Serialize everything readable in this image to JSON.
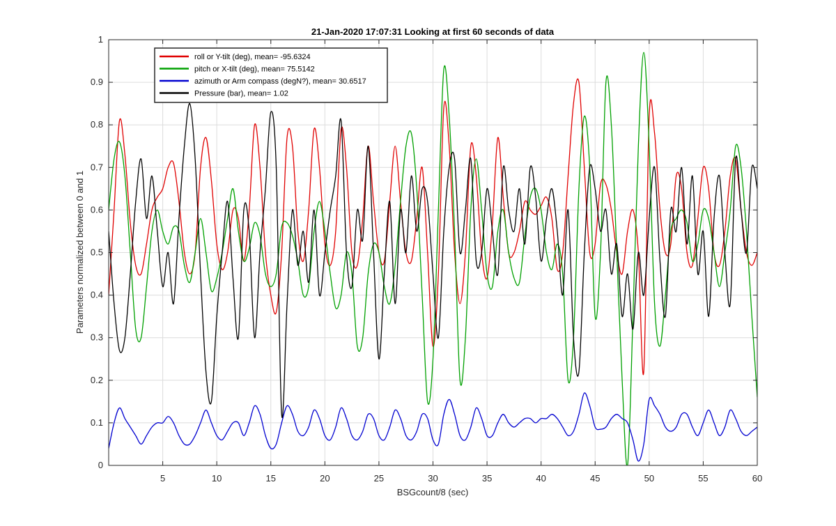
{
  "chart_data": {
    "type": "line",
    "title": "21-Jan-2020 17:07:31 Looking at first 60 seconds of data",
    "xlabel": "BSGcount/8 (sec)",
    "ylabel": "Parameters normalized between 0 and 1",
    "xlim": [
      0,
      60
    ],
    "ylim": [
      0,
      1
    ],
    "xticks": [
      5,
      10,
      15,
      20,
      25,
      30,
      35,
      40,
      45,
      50,
      55,
      60
    ],
    "yticks": [
      0,
      0.1,
      0.2,
      0.3,
      0.4,
      0.5,
      0.6,
      0.7,
      0.8,
      0.9,
      1
    ],
    "xtick_labels": [
      "5",
      "10",
      "15",
      "20",
      "25",
      "30",
      "35",
      "40",
      "45",
      "50",
      "55",
      "60"
    ],
    "ytick_labels": [
      "0",
      "0.1",
      "0.2",
      "0.3",
      "0.4",
      "0.5",
      "0.6",
      "0.7",
      "0.8",
      "0.9",
      "1"
    ],
    "grid": true,
    "legend_position": "top-left",
    "series": [
      {
        "name": "roll or Y-tilt (deg), mean= -95.6324",
        "color": "#e00000",
        "x": [
          0,
          0.5,
          1.0,
          1.5,
          2.0,
          2.5,
          3.0,
          3.5,
          4.0,
          4.5,
          5.0,
          5.5,
          6.0,
          6.5,
          7.0,
          7.5,
          8.0,
          8.5,
          9.0,
          9.5,
          10.0,
          10.5,
          11.0,
          11.5,
          12.0,
          12.5,
          13.0,
          13.5,
          14.0,
          14.5,
          15.0,
          15.5,
          16.0,
          16.5,
          17.0,
          17.5,
          18.0,
          18.5,
          19.0,
          19.5,
          20.0,
          20.5,
          21.0,
          21.5,
          22.0,
          22.5,
          23.0,
          23.5,
          24.0,
          24.5,
          25.0,
          25.5,
          26.0,
          26.5,
          27.0,
          27.5,
          28.0,
          28.5,
          29.0,
          29.5,
          30.0,
          30.5,
          31.0,
          31.5,
          32.0,
          32.5,
          33.0,
          33.5,
          34.0,
          34.5,
          35.0,
          35.5,
          36.0,
          36.5,
          37.0,
          37.5,
          38.0,
          38.5,
          39.0,
          39.5,
          40.0,
          40.5,
          41.0,
          41.5,
          42.0,
          42.5,
          43.0,
          43.5,
          44.0,
          44.5,
          45.0,
          45.5,
          46.0,
          46.5,
          47.0,
          47.5,
          48.0,
          48.5,
          49.0,
          49.5,
          50.0,
          50.5,
          51.0,
          51.5,
          52.0,
          52.5,
          53.0,
          53.5,
          54.0,
          54.5,
          55.0,
          55.5,
          56.0,
          56.5,
          57.0,
          57.5,
          58.0,
          58.5,
          59.0,
          59.5,
          60.0
        ],
        "y": [
          0.4,
          0.6,
          0.81,
          0.73,
          0.57,
          0.47,
          0.45,
          0.52,
          0.6,
          0.63,
          0.65,
          0.7,
          0.71,
          0.62,
          0.5,
          0.45,
          0.5,
          0.7,
          0.77,
          0.67,
          0.52,
          0.46,
          0.5,
          0.6,
          0.58,
          0.48,
          0.6,
          0.8,
          0.7,
          0.5,
          0.4,
          0.36,
          0.5,
          0.77,
          0.75,
          0.55,
          0.48,
          0.6,
          0.79,
          0.7,
          0.52,
          0.47,
          0.55,
          0.79,
          0.7,
          0.5,
          0.47,
          0.58,
          0.75,
          0.62,
          0.5,
          0.48,
          0.62,
          0.75,
          0.62,
          0.5,
          0.48,
          0.58,
          0.7,
          0.5,
          0.28,
          0.45,
          0.84,
          0.75,
          0.5,
          0.38,
          0.5,
          0.75,
          0.68,
          0.5,
          0.44,
          0.57,
          0.77,
          0.63,
          0.5,
          0.5,
          0.55,
          0.62,
          0.6,
          0.59,
          0.61,
          0.63,
          0.58,
          0.46,
          0.5,
          0.68,
          0.85,
          0.9,
          0.7,
          0.5,
          0.52,
          0.66,
          0.66,
          0.6,
          0.5,
          0.45,
          0.55,
          0.6,
          0.5,
          0.22,
          0.82,
          0.78,
          0.6,
          0.5,
          0.52,
          0.68,
          0.65,
          0.5,
          0.47,
          0.58,
          0.7,
          0.65,
          0.5,
          0.47,
          0.55,
          0.68,
          0.72,
          0.6,
          0.5,
          0.47,
          0.5
        ]
      },
      {
        "name": "pitch or X-tilt (deg), mean= 75.5142",
        "color": "#00a000",
        "x": [
          0,
          0.5,
          1.0,
          1.5,
          2.0,
          2.5,
          3.0,
          3.5,
          4.0,
          4.5,
          5.0,
          5.5,
          6.0,
          6.5,
          7.0,
          7.5,
          8.0,
          8.5,
          9.0,
          9.5,
          10.0,
          10.5,
          11.0,
          11.5,
          12.0,
          12.5,
          13.0,
          13.5,
          14.0,
          14.5,
          15.0,
          15.5,
          16.0,
          16.5,
          17.0,
          17.5,
          18.0,
          18.5,
          19.0,
          19.5,
          20.0,
          20.5,
          21.0,
          21.5,
          22.0,
          22.5,
          23.0,
          23.5,
          24.0,
          24.5,
          25.0,
          25.5,
          26.0,
          26.5,
          27.0,
          27.5,
          28.0,
          28.5,
          29.0,
          29.5,
          30.0,
          30.5,
          31.0,
          31.5,
          32.0,
          32.5,
          33.0,
          33.5,
          34.0,
          34.5,
          35.0,
          35.5,
          36.0,
          36.5,
          37.0,
          37.5,
          38.0,
          38.5,
          39.0,
          39.5,
          40.0,
          40.5,
          41.0,
          41.5,
          42.0,
          42.5,
          43.0,
          43.5,
          44.0,
          44.5,
          45.0,
          45.5,
          46.0,
          46.5,
          47.0,
          47.5,
          48.0,
          48.5,
          49.0,
          49.5,
          50.0,
          50.5,
          51.0,
          51.5,
          52.0,
          52.5,
          53.0,
          53.5,
          54.0,
          54.5,
          55.0,
          55.5,
          56.0,
          56.5,
          57.0,
          57.5,
          58.0,
          58.5,
          59.0,
          59.5,
          60.0
        ],
        "y": [
          0.6,
          0.72,
          0.76,
          0.68,
          0.5,
          0.32,
          0.3,
          0.42,
          0.55,
          0.6,
          0.55,
          0.52,
          0.56,
          0.55,
          0.47,
          0.43,
          0.5,
          0.58,
          0.5,
          0.41,
          0.44,
          0.5,
          0.58,
          0.65,
          0.55,
          0.48,
          0.51,
          0.57,
          0.54,
          0.45,
          0.42,
          0.45,
          0.56,
          0.57,
          0.54,
          0.48,
          0.4,
          0.42,
          0.55,
          0.62,
          0.55,
          0.45,
          0.37,
          0.4,
          0.5,
          0.45,
          0.28,
          0.3,
          0.45,
          0.52,
          0.5,
          0.42,
          0.38,
          0.47,
          0.62,
          0.75,
          0.78,
          0.65,
          0.4,
          0.15,
          0.25,
          0.6,
          0.93,
          0.82,
          0.55,
          0.2,
          0.3,
          0.6,
          0.72,
          0.6,
          0.45,
          0.42,
          0.55,
          0.6,
          0.5,
          0.44,
          0.43,
          0.54,
          0.63,
          0.65,
          0.6,
          0.5,
          0.46,
          0.52,
          0.45,
          0.2,
          0.3,
          0.65,
          0.82,
          0.7,
          0.35,
          0.5,
          0.9,
          0.8,
          0.5,
          0.2,
          0.0,
          0.35,
          0.75,
          0.97,
          0.75,
          0.38,
          0.28,
          0.4,
          0.55,
          0.58,
          0.6,
          0.57,
          0.48,
          0.52,
          0.6,
          0.58,
          0.5,
          0.42,
          0.5,
          0.6,
          0.75,
          0.7,
          0.55,
          0.35,
          0.16
        ]
      },
      {
        "name": "azimuth or Arm compass (degN?), mean= 30.6517",
        "color": "#0000d0",
        "x": [
          0,
          0.5,
          1.0,
          1.5,
          2.0,
          2.5,
          3.0,
          3.5,
          4.0,
          4.5,
          5.0,
          5.5,
          6.0,
          6.5,
          7.0,
          7.5,
          8.0,
          8.5,
          9.0,
          9.5,
          10.0,
          10.5,
          11.0,
          11.5,
          12.0,
          12.5,
          13.0,
          13.5,
          14.0,
          14.5,
          15.0,
          15.5,
          16.0,
          16.5,
          17.0,
          17.5,
          18.0,
          18.5,
          19.0,
          19.5,
          20.0,
          20.5,
          21.0,
          21.5,
          22.0,
          22.5,
          23.0,
          23.5,
          24.0,
          24.5,
          25.0,
          25.5,
          26.0,
          26.5,
          27.0,
          27.5,
          28.0,
          28.5,
          29.0,
          29.5,
          30.0,
          30.5,
          31.0,
          31.5,
          32.0,
          32.5,
          33.0,
          33.5,
          34.0,
          34.5,
          35.0,
          35.5,
          36.0,
          36.5,
          37.0,
          37.5,
          38.0,
          38.5,
          39.0,
          39.5,
          40.0,
          40.5,
          41.0,
          41.5,
          42.0,
          42.5,
          43.0,
          43.5,
          44.0,
          44.5,
          45.0,
          45.5,
          46.0,
          46.5,
          47.0,
          47.5,
          48.0,
          48.5,
          49.0,
          49.5,
          50.0,
          50.5,
          51.0,
          51.5,
          52.0,
          52.5,
          53.0,
          53.5,
          54.0,
          54.5,
          55.0,
          55.5,
          56.0,
          56.5,
          57.0,
          57.5,
          58.0,
          58.5,
          59.0,
          59.5,
          60.0
        ],
        "y": [
          0.04,
          0.1,
          0.135,
          0.11,
          0.09,
          0.07,
          0.05,
          0.07,
          0.09,
          0.1,
          0.1,
          0.115,
          0.1,
          0.07,
          0.05,
          0.05,
          0.07,
          0.1,
          0.13,
          0.1,
          0.07,
          0.06,
          0.08,
          0.1,
          0.1,
          0.07,
          0.1,
          0.14,
          0.12,
          0.07,
          0.04,
          0.05,
          0.1,
          0.14,
          0.12,
          0.08,
          0.07,
          0.09,
          0.13,
          0.11,
          0.07,
          0.06,
          0.09,
          0.135,
          0.11,
          0.07,
          0.06,
          0.08,
          0.12,
          0.11,
          0.07,
          0.06,
          0.09,
          0.13,
          0.11,
          0.07,
          0.06,
          0.08,
          0.12,
          0.11,
          0.06,
          0.05,
          0.12,
          0.155,
          0.12,
          0.07,
          0.06,
          0.09,
          0.135,
          0.11,
          0.07,
          0.07,
          0.1,
          0.12,
          0.1,
          0.09,
          0.1,
          0.11,
          0.11,
          0.1,
          0.11,
          0.11,
          0.12,
          0.11,
          0.09,
          0.07,
          0.08,
          0.12,
          0.17,
          0.14,
          0.09,
          0.085,
          0.09,
          0.11,
          0.12,
          0.11,
          0.1,
          0.06,
          0.01,
          0.05,
          0.155,
          0.14,
          0.12,
          0.09,
          0.08,
          0.09,
          0.12,
          0.12,
          0.09,
          0.07,
          0.1,
          0.13,
          0.1,
          0.07,
          0.09,
          0.13,
          0.11,
          0.08,
          0.07,
          0.08,
          0.09
        ]
      },
      {
        "name": "Pressure (bar), mean= 1.02",
        "color": "#000000",
        "x": [
          0,
          0.5,
          1.0,
          1.5,
          2.0,
          2.5,
          3.0,
          3.5,
          4.0,
          4.5,
          5.0,
          5.5,
          6.0,
          6.5,
          7.0,
          7.5,
          8.0,
          8.5,
          9.0,
          9.5,
          10.0,
          10.5,
          11.0,
          11.5,
          12.0,
          12.5,
          13.0,
          13.5,
          14.0,
          14.5,
          15.0,
          15.5,
          16.0,
          16.5,
          17.0,
          17.5,
          18.0,
          18.5,
          19.0,
          19.5,
          20.0,
          20.5,
          21.0,
          21.5,
          22.0,
          22.5,
          23.0,
          23.5,
          24.0,
          24.5,
          25.0,
          25.5,
          26.0,
          26.5,
          27.0,
          27.5,
          28.0,
          28.5,
          29.0,
          29.5,
          30.0,
          30.5,
          31.0,
          31.5,
          32.0,
          32.5,
          33.0,
          33.5,
          34.0,
          34.5,
          35.0,
          35.5,
          36.0,
          36.5,
          37.0,
          37.5,
          38.0,
          38.5,
          39.0,
          39.5,
          40.0,
          40.5,
          41.0,
          41.5,
          42.0,
          42.5,
          43.0,
          43.5,
          44.0,
          44.5,
          45.0,
          45.5,
          46.0,
          46.5,
          47.0,
          47.5,
          48.0,
          48.5,
          49.0,
          49.5,
          50.0,
          50.5,
          51.0,
          51.5,
          52.0,
          52.5,
          53.0,
          53.5,
          54.0,
          54.5,
          55.0,
          55.5,
          56.0,
          56.5,
          57.0,
          57.5,
          58.0,
          58.5,
          59.0,
          59.5,
          60.0
        ],
        "y": [
          0.55,
          0.38,
          0.27,
          0.3,
          0.45,
          0.62,
          0.72,
          0.58,
          0.68,
          0.55,
          0.42,
          0.5,
          0.38,
          0.58,
          0.75,
          0.85,
          0.72,
          0.45,
          0.22,
          0.15,
          0.35,
          0.5,
          0.62,
          0.44,
          0.3,
          0.6,
          0.55,
          0.3,
          0.5,
          0.65,
          0.83,
          0.7,
          0.12,
          0.38,
          0.6,
          0.47,
          0.55,
          0.43,
          0.6,
          0.4,
          0.5,
          0.6,
          0.68,
          0.81,
          0.5,
          0.42,
          0.6,
          0.53,
          0.75,
          0.5,
          0.25,
          0.45,
          0.62,
          0.38,
          0.6,
          0.5,
          0.68,
          0.55,
          0.65,
          0.62,
          0.45,
          0.3,
          0.55,
          0.7,
          0.72,
          0.5,
          0.6,
          0.72,
          0.48,
          0.5,
          0.65,
          0.55,
          0.45,
          0.7,
          0.6,
          0.55,
          0.65,
          0.52,
          0.7,
          0.63,
          0.48,
          0.58,
          0.65,
          0.55,
          0.4,
          0.6,
          0.3,
          0.22,
          0.5,
          0.7,
          0.65,
          0.55,
          0.6,
          0.45,
          0.52,
          0.35,
          0.45,
          0.32,
          0.5,
          0.4,
          0.58,
          0.7,
          0.48,
          0.35,
          0.6,
          0.55,
          0.7,
          0.52,
          0.68,
          0.45,
          0.55,
          0.35,
          0.58,
          0.68,
          0.5,
          0.38,
          0.72,
          0.6,
          0.5,
          0.7,
          0.65
        ]
      }
    ]
  }
}
